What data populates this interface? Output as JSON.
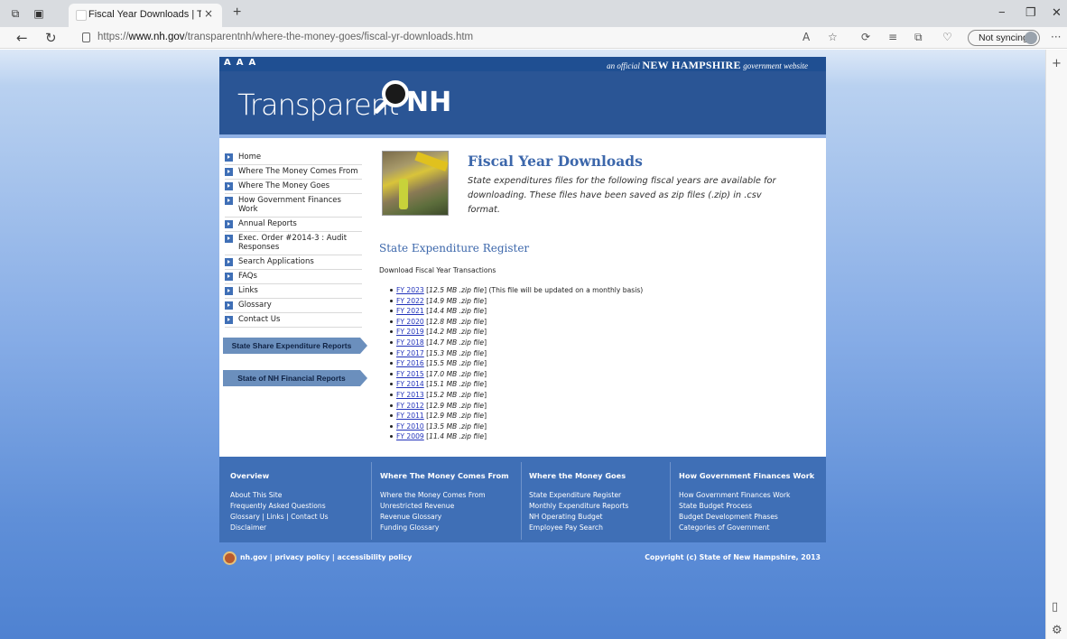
{
  "browser": {
    "tab_title": "Fiscal Year Downloads | Transparent NH",
    "tab_close": "×",
    "new_tab": "+",
    "url_prefix": "https://",
    "url_host": "www.nh.gov",
    "url_path": "/transparentnh/where-the-money-goes/fiscal-yr-downloads.htm",
    "sync_label": "Not syncing",
    "more_label": "···",
    "add_label": "+"
  },
  "site": {
    "text_size_controls": [
      "A",
      "A",
      "A"
    ],
    "official_prefix": "an official",
    "official_state": "NEW HAMPSHIRE",
    "official_suffix": "government website",
    "logo_text": "Transparent",
    "logo_nh": "NH"
  },
  "nav": {
    "items": [
      "Home",
      "Where The Money Comes From",
      "Where The Money Goes",
      "How Government Finances Work",
      "Annual Reports",
      "Exec. Order #2014-3 : Audit Responses",
      "Search Applications",
      "FAQs",
      "Links",
      "Glossary",
      "Contact Us"
    ],
    "buttons": [
      "State Share Expenditure Reports",
      "State of NH Financial Reports"
    ]
  },
  "main": {
    "title": "Fiscal Year Downloads",
    "intro": "State expenditures files for the following fiscal years are available for downloading. These files have been saved as zip files (.zip) in .csv format.",
    "section_title": "State Expenditure Register",
    "download_label": "Download Fiscal Year Transactions",
    "files": [
      {
        "year": "FY 2023",
        "size": "12.5 MB .zip file",
        "note": "(This file will be updated on a monthly basis)"
      },
      {
        "year": "FY 2022",
        "size": "14.9 MB .zip file",
        "note": ""
      },
      {
        "year": "FY 2021",
        "size": "14.4 MB .zip file",
        "note": ""
      },
      {
        "year": "FY 2020",
        "size": "12.8 MB .zip file",
        "note": ""
      },
      {
        "year": "FY 2019",
        "size": "14.2 MB .zip file",
        "note": ""
      },
      {
        "year": "FY 2018",
        "size": "14.7 MB .zip file",
        "note": ""
      },
      {
        "year": "FY 2017",
        "size": "15.3 MB .zip file",
        "note": ""
      },
      {
        "year": "FY 2016",
        "size": "15.5 MB .zip file",
        "note": ""
      },
      {
        "year": "FY 2015",
        "size": "17.0 MB .zip file",
        "note": ""
      },
      {
        "year": "FY 2014",
        "size": "15.1 MB .zip file",
        "note": ""
      },
      {
        "year": "FY 2013",
        "size": "15.2 MB .zip file",
        "note": ""
      },
      {
        "year": "FY 2012",
        "size": "12.9 MB .zip file",
        "note": ""
      },
      {
        "year": "FY 2011",
        "size": "12.9 MB .zip file",
        "note": ""
      },
      {
        "year": "FY 2010",
        "size": "13.5 MB .zip file",
        "note": ""
      },
      {
        "year": "FY 2009",
        "size": "11.4 MB .zip file",
        "note": ""
      }
    ]
  },
  "footer": {
    "columns": [
      {
        "heading": "Overview",
        "links": [
          "About This Site",
          "Frequently Asked Questions",
          "Glossary | Links | Contact Us",
          "Disclaimer"
        ]
      },
      {
        "heading": "Where The Money Comes From",
        "links": [
          "Where the Money Comes From",
          "Unrestricted Revenue",
          "Revenue Glossary",
          "Funding Glossary"
        ]
      },
      {
        "heading": "Where the Money Goes",
        "links": [
          "State Expenditure Register",
          "Monthly Expenditure Reports",
          "NH Operating Budget",
          "Employee Pay Search"
        ]
      },
      {
        "heading": "How Government Finances Work",
        "links": [
          "How Government Finances Work",
          "State Budget Process",
          "Budget Development Phases",
          "Categories of Government"
        ]
      }
    ],
    "bottom_left": "nh.gov | privacy policy | accessibility policy",
    "copyright": "Copyright (c) State of New Hampshire, 2013"
  }
}
